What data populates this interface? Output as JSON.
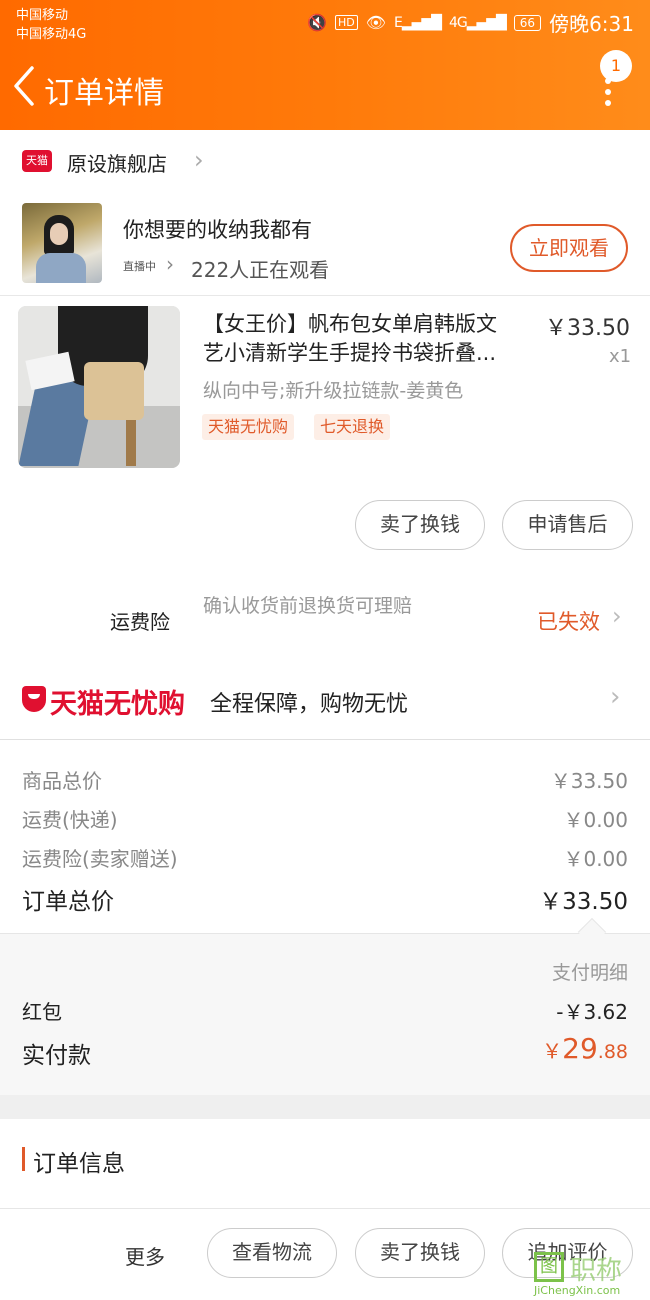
{
  "status_bar": {
    "carrier_1": "中国移动",
    "carrier_2": "中国移动4G",
    "hd": "HD",
    "signal_1": "E",
    "signal_2": "4G",
    "battery": "66",
    "time": "傍晚6:31"
  },
  "header": {
    "title": "订单详情",
    "notification_count": "1"
  },
  "shop": {
    "logo_text": "天猫",
    "name": "原设旗舰店"
  },
  "live": {
    "title": "你想要的收纳我都有",
    "tag": "直播中",
    "viewers": "222人正在观看",
    "watch_button": "立即观看"
  },
  "product": {
    "title_line1": "【女王价】帆布包女单肩韩版文",
    "title_line2": "艺小清新学生手提拎书袋折叠...",
    "price": "￥33.50",
    "qty": "x1",
    "sku": "纵向中号;新升级拉链款-姜黄色",
    "tags": [
      "天猫无忧购",
      "七天退换"
    ],
    "buttons": {
      "sell": "卖了换钱",
      "after_sale": "申请售后"
    }
  },
  "insurance": {
    "label": "运费险",
    "desc": "确认收货前退换货可理赔",
    "status": "已失效"
  },
  "wuyou": {
    "brand": "天猫无忧购",
    "text": "全程保障，购物无忧"
  },
  "summary": {
    "rows": [
      {
        "label": "商品总价",
        "value": "￥33.50"
      },
      {
        "label": "运费(快递)",
        "value": "￥0.00"
      },
      {
        "label": "运费险(卖家赠送)",
        "value": "￥0.00"
      }
    ],
    "total_label": "订单总价",
    "total_value": "￥33.50"
  },
  "payment": {
    "detail_label": "支付明细",
    "hongbao_label": "红包",
    "hongbao_value": "-￥3.62",
    "paid_label": "实付款",
    "paid_currency": "￥",
    "paid_integer": "29",
    "paid_cents": ".88"
  },
  "order_info": {
    "title": "订单信息"
  },
  "bottom_bar": {
    "more": "更多",
    "logistics": "查看物流",
    "sell": "卖了换钱",
    "review": "追加评价"
  },
  "watermark": {
    "box": "图",
    "cn": "职称",
    "en": "JiChengXin.com"
  },
  "colors": {
    "header_start": "#ff6a00",
    "header_end": "#ff8c1a",
    "accent": "#e05a2a",
    "tmall_red": "#e01030"
  }
}
